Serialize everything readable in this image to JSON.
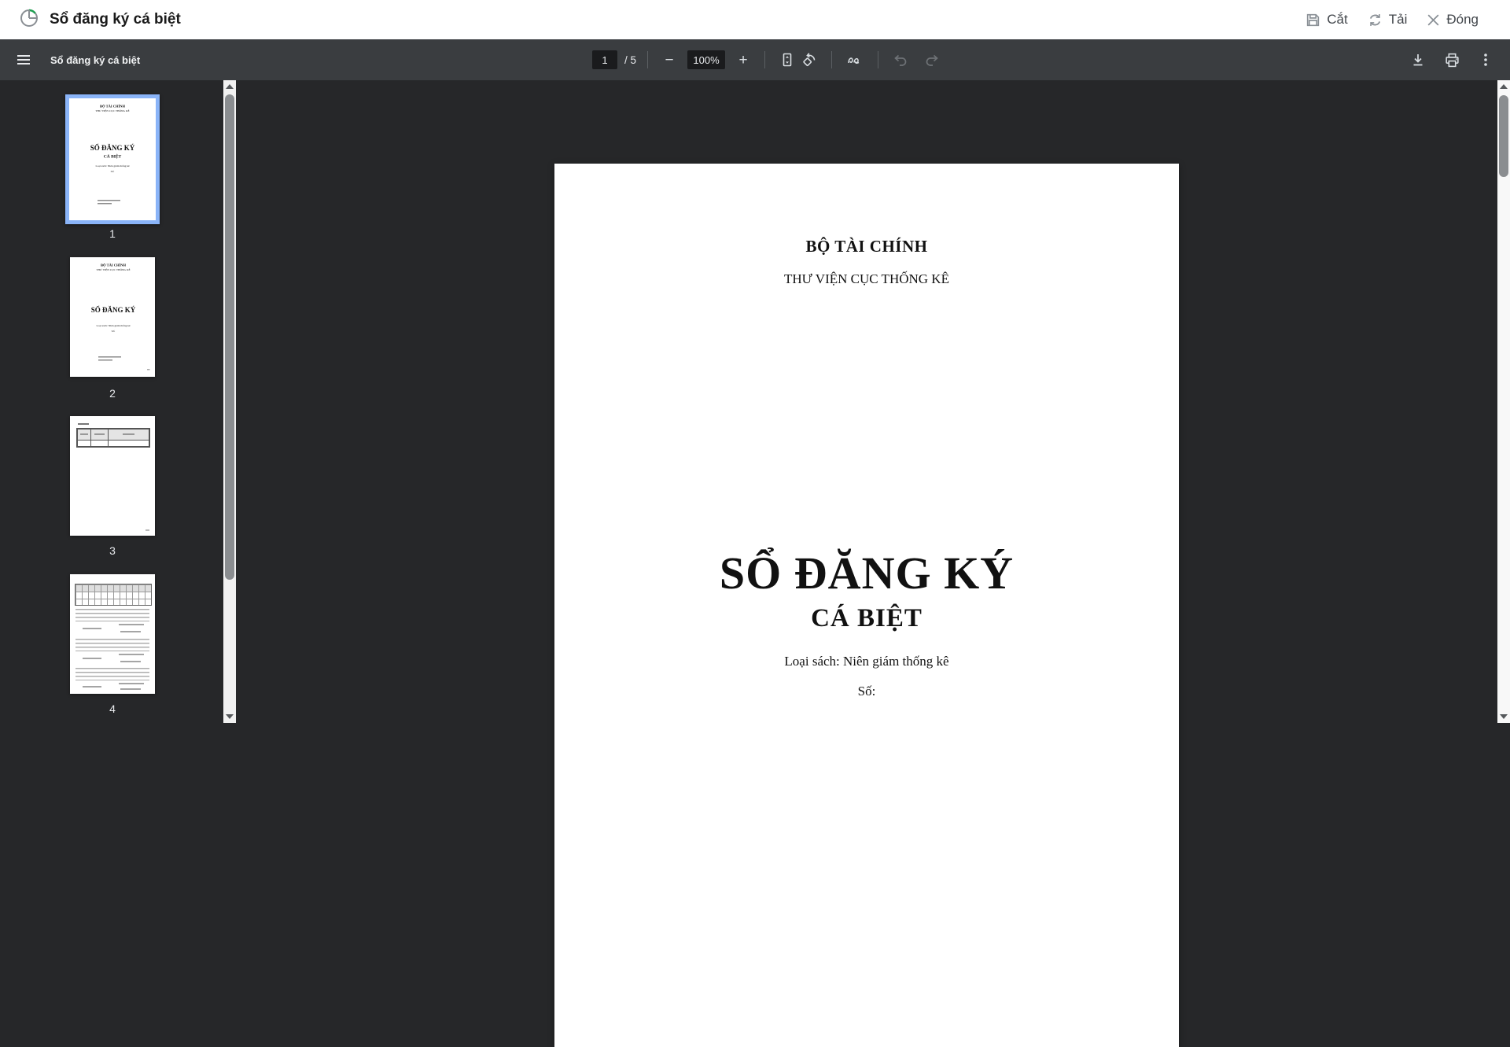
{
  "window": {
    "title": "Sổ đăng ký cá biệt",
    "actions": {
      "cut": "Cắt",
      "reload": "Tải",
      "close": "Đóng"
    }
  },
  "pdf_toolbar": {
    "document_title": "Sổ đăng ký cá biệt",
    "page_input": "1",
    "page_count": "/ 5",
    "zoom_level": "100%"
  },
  "thumbnails": [
    {
      "page_label": "1",
      "selected": true
    },
    {
      "page_label": "2",
      "selected": false
    },
    {
      "page_label": "3",
      "selected": false
    },
    {
      "page_label": "4",
      "selected": false
    }
  ],
  "document": {
    "header_line1": "BỘ TÀI CHÍNH",
    "header_line2": "THƯ VIỆN CỤC THỐNG KÊ",
    "title_line1": "SỔ ĐĂNG KÝ",
    "title_line2": "CÁ BIỆT",
    "subtitle": "Loại sách: Niên giám thống kê",
    "number_label": "Số:"
  },
  "colors": {
    "selection_blue": "#8ab4f8",
    "toolbar_bg": "#3a3d40",
    "viewer_bg": "#262729",
    "icon_green": "#1e9e50"
  }
}
